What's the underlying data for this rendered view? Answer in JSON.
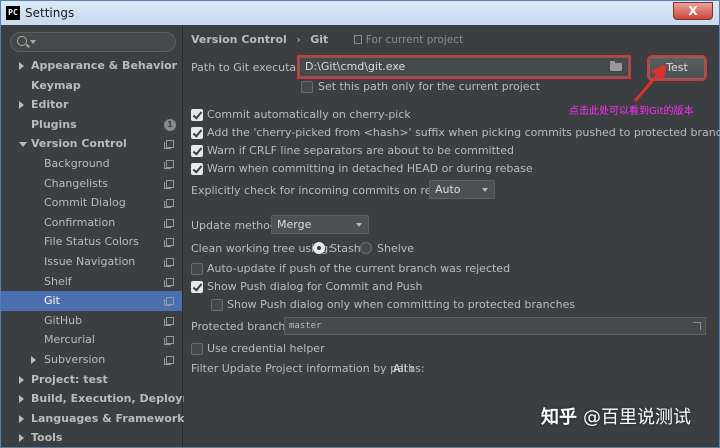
{
  "window": {
    "title": "Settings",
    "app_icon_text": "PC",
    "close_label": "X"
  },
  "sidebar": {
    "search_placeholder": "",
    "items": [
      {
        "label": "Appearance & Behavior",
        "level": 0,
        "bold": true,
        "arrow": "right"
      },
      {
        "label": "Keymap",
        "level": 0,
        "bold": true
      },
      {
        "label": "Editor",
        "level": 0,
        "bold": true,
        "arrow": "right"
      },
      {
        "label": "Plugins",
        "level": 0,
        "bold": true,
        "badge": "1"
      },
      {
        "label": "Version Control",
        "level": 0,
        "bold": true,
        "arrow": "down",
        "copy": true
      },
      {
        "label": "Background",
        "level": 1,
        "copy": true
      },
      {
        "label": "Changelists",
        "level": 1,
        "copy": true
      },
      {
        "label": "Commit Dialog",
        "level": 1,
        "copy": true
      },
      {
        "label": "Confirmation",
        "level": 1,
        "copy": true
      },
      {
        "label": "File Status Colors",
        "level": 1,
        "copy": true
      },
      {
        "label": "Issue Navigation",
        "level": 1,
        "copy": true
      },
      {
        "label": "Shelf",
        "level": 1,
        "copy": true
      },
      {
        "label": "Git",
        "level": 1,
        "copy": true,
        "selected": true
      },
      {
        "label": "GitHub",
        "level": 1,
        "copy": true
      },
      {
        "label": "Mercurial",
        "level": 1,
        "copy": true
      },
      {
        "label": "Subversion",
        "level": 1,
        "copy": true,
        "arrow": "right"
      },
      {
        "label": "Project: test",
        "level": 0,
        "bold": true,
        "arrow": "right"
      },
      {
        "label": "Build, Execution, Deployment",
        "level": 0,
        "bold": true,
        "arrow": "right"
      },
      {
        "label": "Languages & Frameworks",
        "level": 0,
        "bold": true,
        "arrow": "right"
      },
      {
        "label": "Tools",
        "level": 0,
        "bold": true,
        "arrow": "right"
      }
    ]
  },
  "breadcrumb": {
    "parent": "Version Control",
    "separator": "›",
    "current": "Git",
    "scope": "For current project"
  },
  "path": {
    "label": "Path to Git executable:",
    "value": "D:\\Git\\cmd\\git.exe",
    "test_label": "Test",
    "only_current_label": "Set this path only for the current project",
    "only_current_checked": false
  },
  "options": {
    "cherry_pick": {
      "label": "Commit automatically on cherry-pick",
      "checked": true
    },
    "cherry_suffix": {
      "label": "Add the 'cherry-picked from <hash>' suffix when picking commits pushed to protected branches",
      "checked": true
    },
    "crlf": {
      "label": "Warn if CRLF line separators are about to be committed",
      "checked": true
    },
    "detached": {
      "label": "Warn when committing in detached HEAD or during rebase",
      "checked": true
    }
  },
  "incoming": {
    "label": "Explicitly check for incoming commits on remotes:",
    "value": "Auto"
  },
  "update": {
    "method_label": "Update method:",
    "method_value": "Merge",
    "clean_label": "Clean working tree using:",
    "stash_label": "Stash",
    "shelve_label": "Shelve",
    "selected": "Stash"
  },
  "push": {
    "auto_update": {
      "label": "Auto-update if push of the current branch was rejected",
      "checked": false
    },
    "show_dialog": {
      "label": "Show Push dialog for Commit and Push",
      "checked": true
    },
    "show_protected": {
      "label": "Show Push dialog only when committing to protected branches",
      "checked": false
    }
  },
  "protected": {
    "label": "Protected branches:",
    "value": "master"
  },
  "credential": {
    "label": "Use credential helper",
    "checked": false
  },
  "filter": {
    "label": "Filter Update Project information by paths:",
    "value": "All"
  },
  "annotation": {
    "text": "点击此处可以看到Git的版本",
    "color": "#ff2dff"
  },
  "watermark": {
    "logo": "知乎",
    "author": "@百里说测试"
  },
  "colors": {
    "background": "#3c3f41",
    "selection": "#4b6eaf",
    "highlight_box": "#d0393a",
    "arrow": "#e0302a"
  }
}
